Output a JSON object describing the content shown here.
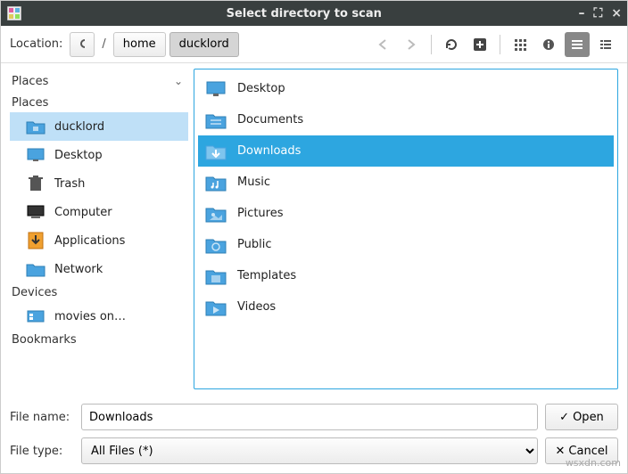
{
  "title": "Select directory to scan",
  "toolbar": {
    "location_label": "Location:",
    "path": {
      "root": "/",
      "home": "home",
      "current": "ducklord"
    }
  },
  "sidebar": {
    "header": "Places",
    "sections": {
      "places": {
        "label": "Places",
        "items": [
          {
            "id": "ducklord",
            "label": "ducklord",
            "icon": "home-folder-icon",
            "selected": true
          },
          {
            "id": "desktop",
            "label": "Desktop",
            "icon": "desktop-icon"
          },
          {
            "id": "trash",
            "label": "Trash",
            "icon": "trash-icon"
          },
          {
            "id": "computer",
            "label": "Computer",
            "icon": "computer-icon"
          },
          {
            "id": "applications",
            "label": "Applications",
            "icon": "download-icon"
          },
          {
            "id": "network",
            "label": "Network",
            "icon": "network-folder-icon"
          }
        ]
      },
      "devices": {
        "label": "Devices",
        "items": [
          {
            "id": "movies",
            "label": "movies on…",
            "icon": "disk-icon"
          }
        ]
      },
      "bookmarks": {
        "label": "Bookmarks",
        "items": []
      }
    }
  },
  "filelist": {
    "items": [
      {
        "id": "desktop",
        "label": "Desktop",
        "icon": "desktop-icon"
      },
      {
        "id": "documents",
        "label": "Documents",
        "icon": "documents-folder-icon"
      },
      {
        "id": "downloads",
        "label": "Downloads",
        "icon": "downloads-folder-icon",
        "selected": true
      },
      {
        "id": "music",
        "label": "Music",
        "icon": "music-folder-icon"
      },
      {
        "id": "pictures",
        "label": "Pictures",
        "icon": "pictures-folder-icon"
      },
      {
        "id": "public",
        "label": "Public",
        "icon": "public-folder-icon"
      },
      {
        "id": "templates",
        "label": "Templates",
        "icon": "templates-folder-icon"
      },
      {
        "id": "videos",
        "label": "Videos",
        "icon": "videos-folder-icon"
      }
    ]
  },
  "footer": {
    "filename_label": "File name:",
    "filename_value": "Downloads",
    "filetype_label": "File type:",
    "filetype_value": "All Files (*)",
    "open_label": "Open",
    "cancel_label": "Cancel"
  },
  "watermark": "wsxdn.com"
}
